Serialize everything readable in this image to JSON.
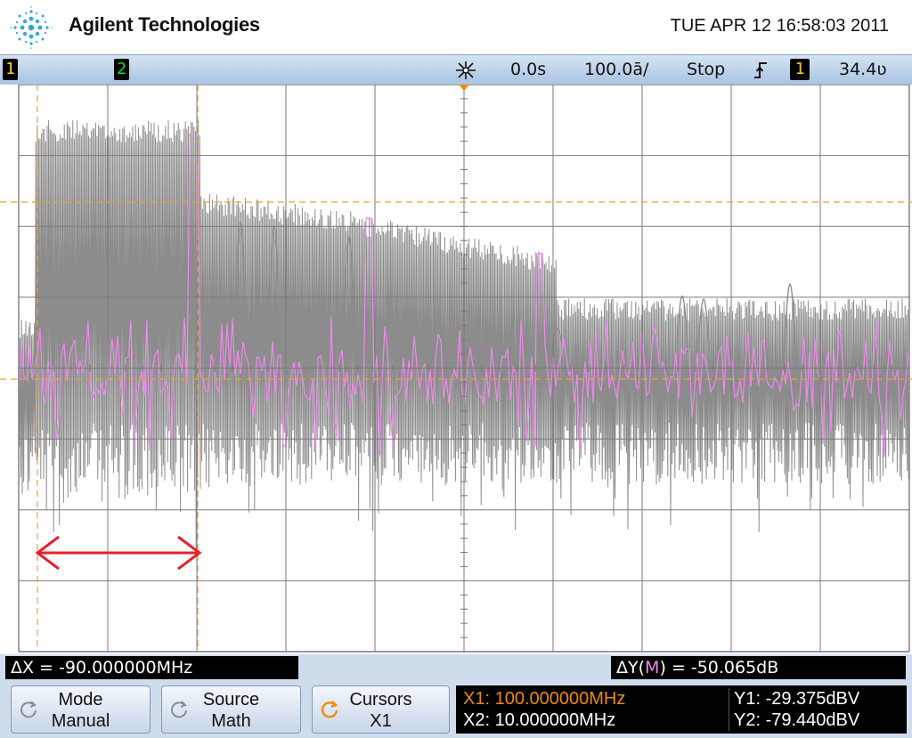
{
  "header": {
    "brand": "Agilent Technologies",
    "datetime": "TUE APR 12 16:58:03 2011"
  },
  "statusbar": {
    "ch1_label": "1",
    "ch2_label": "2",
    "trigger_position": "0.0s",
    "timebase": "100.0ā/",
    "run_state": "Stop",
    "trigger_slope_icon": "rising-edge-icon",
    "trigger_source": "1",
    "trigger_level": "34.4ʋ"
  },
  "colors": {
    "trace_fft": "#8c8c8c",
    "trace_math": "#ee88ee",
    "cursor": "#f0a030",
    "annotation_arrow": "#e8202a",
    "grid": "#7a7a7a"
  },
  "readouts": {
    "delta_x": "ΔX = -90.000000MHz",
    "delta_y_prefix": "ΔY(",
    "delta_y_source": "M",
    "delta_y_suffix": ") = -50.065dB"
  },
  "softkeys": {
    "mode_title": "Mode",
    "mode_value": "Manual",
    "source_title": "Source",
    "source_value": "Math",
    "cursors_title": "Cursors",
    "cursors_value": "X1"
  },
  "cursor_values": {
    "x1": "X1: 100.000000MHz",
    "x2": "X2: 10.000000MHz",
    "y1": "Y1: -29.375dBV",
    "y2": "Y2: -79.440dBV"
  }
}
